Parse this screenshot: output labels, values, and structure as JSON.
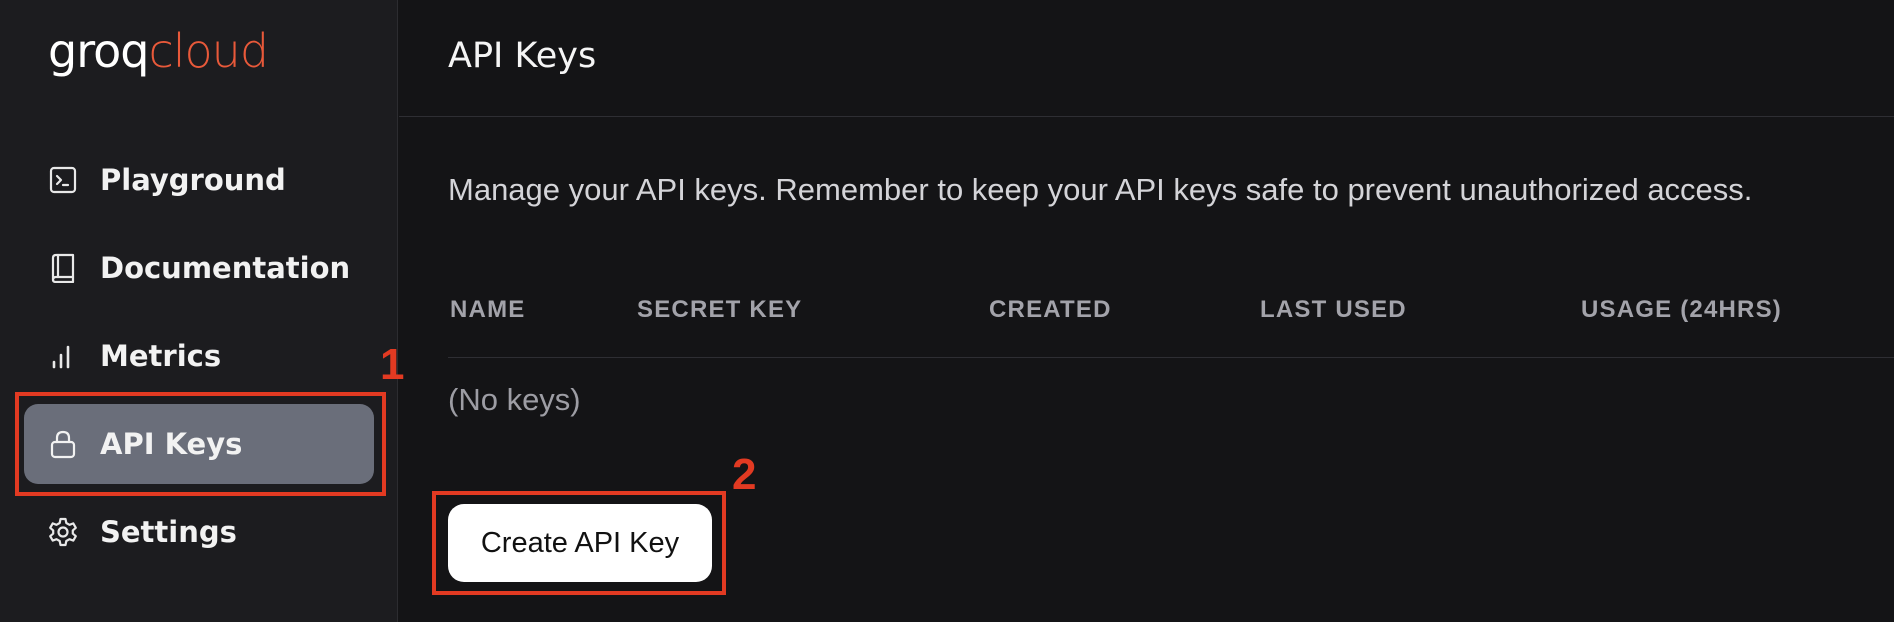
{
  "logo": {
    "part1": "groq",
    "part2": "cloud"
  },
  "sidebar": {
    "items": [
      {
        "label": "Playground",
        "icon": "terminal-icon",
        "active": false
      },
      {
        "label": "Documentation",
        "icon": "book-icon",
        "active": false
      },
      {
        "label": "Metrics",
        "icon": "bar-chart-icon",
        "active": false
      },
      {
        "label": "API Keys",
        "icon": "lock-icon",
        "active": true
      },
      {
        "label": "Settings",
        "icon": "gear-icon",
        "active": false
      }
    ]
  },
  "header": {
    "title": "API Keys"
  },
  "main": {
    "description": "Manage your API keys. Remember to keep your API keys safe to prevent unauthorized access.",
    "table": {
      "columns": [
        "NAME",
        "SECRET KEY",
        "CREATED",
        "LAST USED",
        "USAGE (24HRS)"
      ],
      "empty_text": "(No keys)"
    },
    "create_button_label": "Create API Key"
  },
  "annotations": {
    "marker1": "1",
    "marker2": "2",
    "color": "#e23a22"
  },
  "colors": {
    "accent": "#e8593a",
    "active_bg": "#6a6e7a",
    "background": "#141416"
  }
}
